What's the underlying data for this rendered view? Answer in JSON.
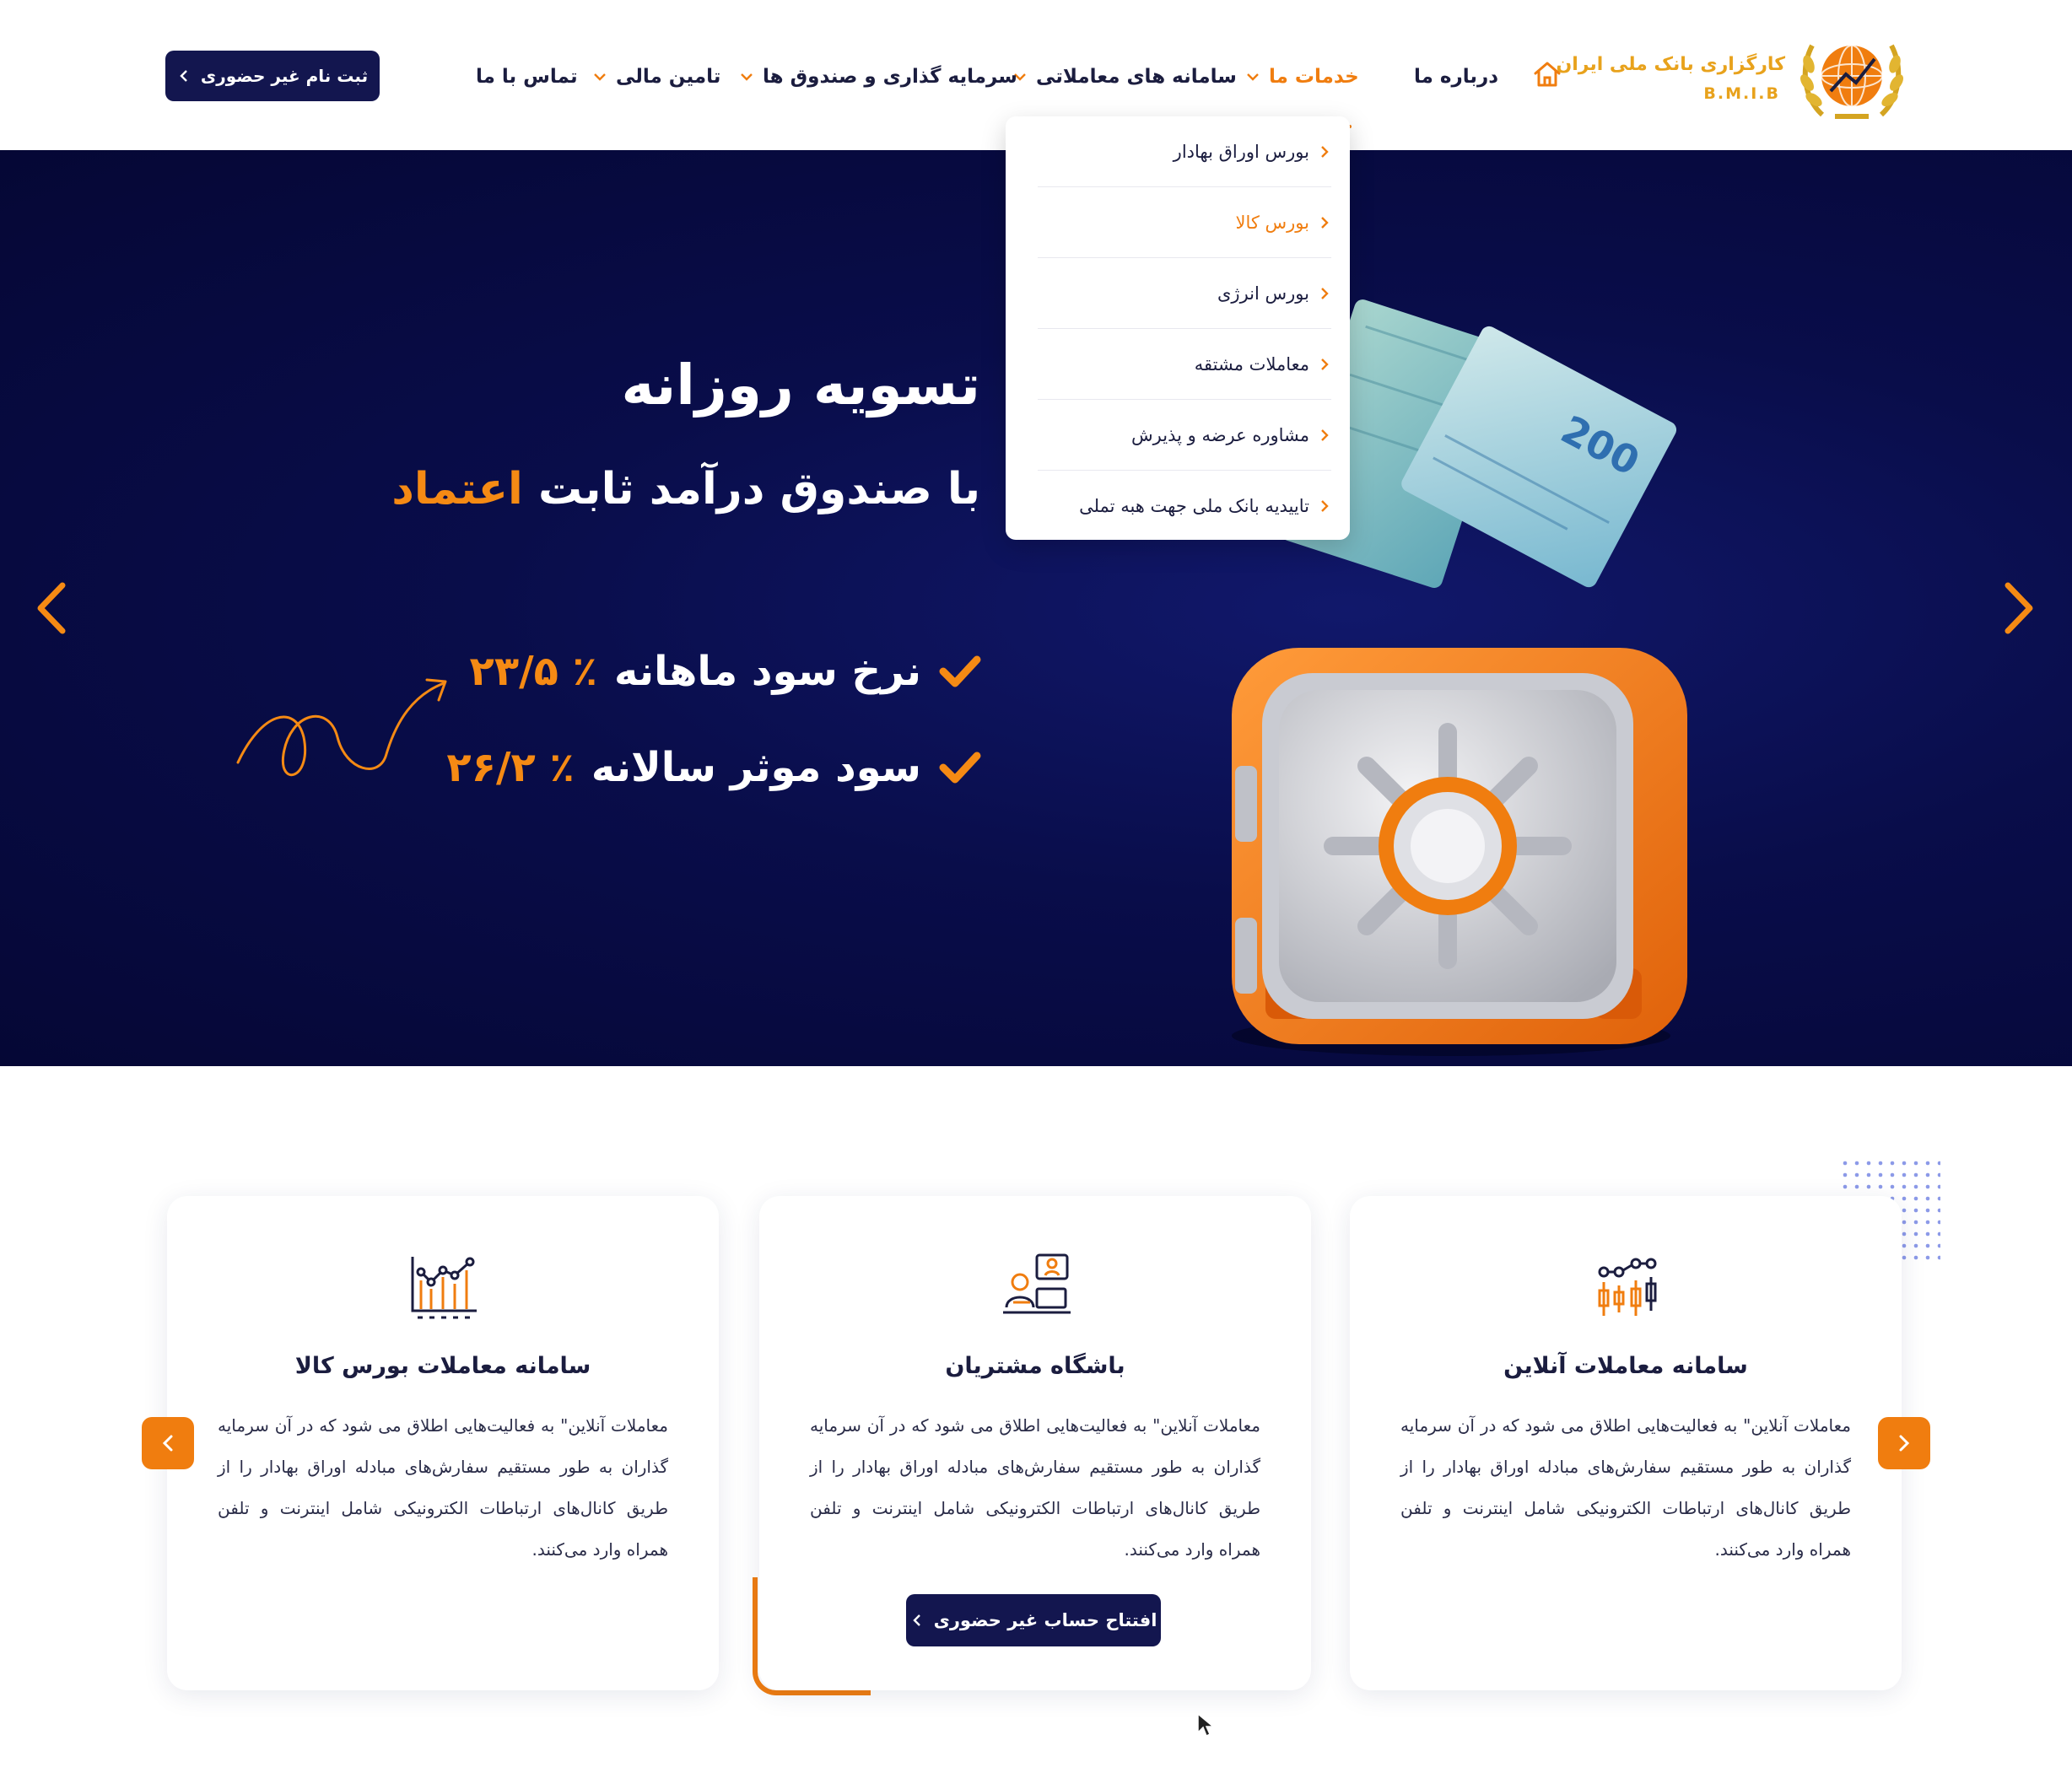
{
  "header": {
    "logo": {
      "title": "کارگزاری بانک ملی ایران",
      "subtitle": "B.M.I.B"
    },
    "nav": [
      {
        "label": "درباره ما"
      },
      {
        "label": "خدمات ما",
        "active": true
      },
      {
        "label": "سامانه های معاملاتی"
      },
      {
        "label": "سرمایه گذاری و صندوق ها"
      },
      {
        "label": "تامین مالی"
      },
      {
        "label": "تماس با ما"
      }
    ],
    "register_button": "ثبت نام غیر حضوری"
  },
  "dropdown": {
    "items": [
      {
        "label": "بورس اوراق بهادار"
      },
      {
        "label": "بورس کالا",
        "active": true
      },
      {
        "label": "بورس انرژی"
      },
      {
        "label": "معاملات مشتقه"
      },
      {
        "label": "مشاوره عرضه و پذیرش"
      },
      {
        "label": "تاییدیه بانک ملی جهت هبه تملی"
      }
    ]
  },
  "hero": {
    "title": "تسویه روزانه",
    "subtitle_prefix": "با صندوق درآمد ثابت",
    "subtitle_accent": "اعتماد",
    "lines": [
      {
        "label": "نرخ سود ماهانه",
        "value": "٪ ۲۳/۵"
      },
      {
        "label": "سود موثر سالانه",
        "value": "٪ ۲۶/۲"
      }
    ],
    "banknote_value": "200",
    "colors": {
      "accent": "#f58a14",
      "background": "#090d4a"
    }
  },
  "cards": [
    {
      "icon": "candlestick-chart-icon",
      "title": "سامانه معاملات آنلاین",
      "text": "معاملات آنلاین\" به فعالیت‌هایی اطلاق می شود که در آن سرمایه گذاران به طور مستقیم سفارش‌های مبادله اوراق بهادار را از طریق کانال‌های ارتباطات الکترونیکی شامل اینترنت و تلفن همراه وارد می‌کنند."
    },
    {
      "icon": "customer-club-icon",
      "title": "باشگاه مشتریان",
      "text": "معاملات آنلاین\" به فعالیت‌هایی اطلاق می شود که در آن سرمایه گذاران به طور مستقیم سفارش‌های مبادله اوراق بهادار را از طریق کانال‌های ارتباطات الکترونیکی شامل اینترنت و تلفن همراه وارد می‌کنند.",
      "button": "افتتاح حساب غیر حضوری"
    },
    {
      "icon": "bar-line-chart-icon",
      "title": "سامانه معاملات بورس کالا",
      "text": "معاملات آنلاین\" به فعالیت‌هایی اطلاق می شود که در آن سرمایه گذاران به طور مستقیم سفارش‌های مبادله اوراق بهادار را از طریق کانال‌های ارتباطات الکترونیکی شامل اینترنت و تلفن همراه وارد می‌کنند."
    }
  ]
}
